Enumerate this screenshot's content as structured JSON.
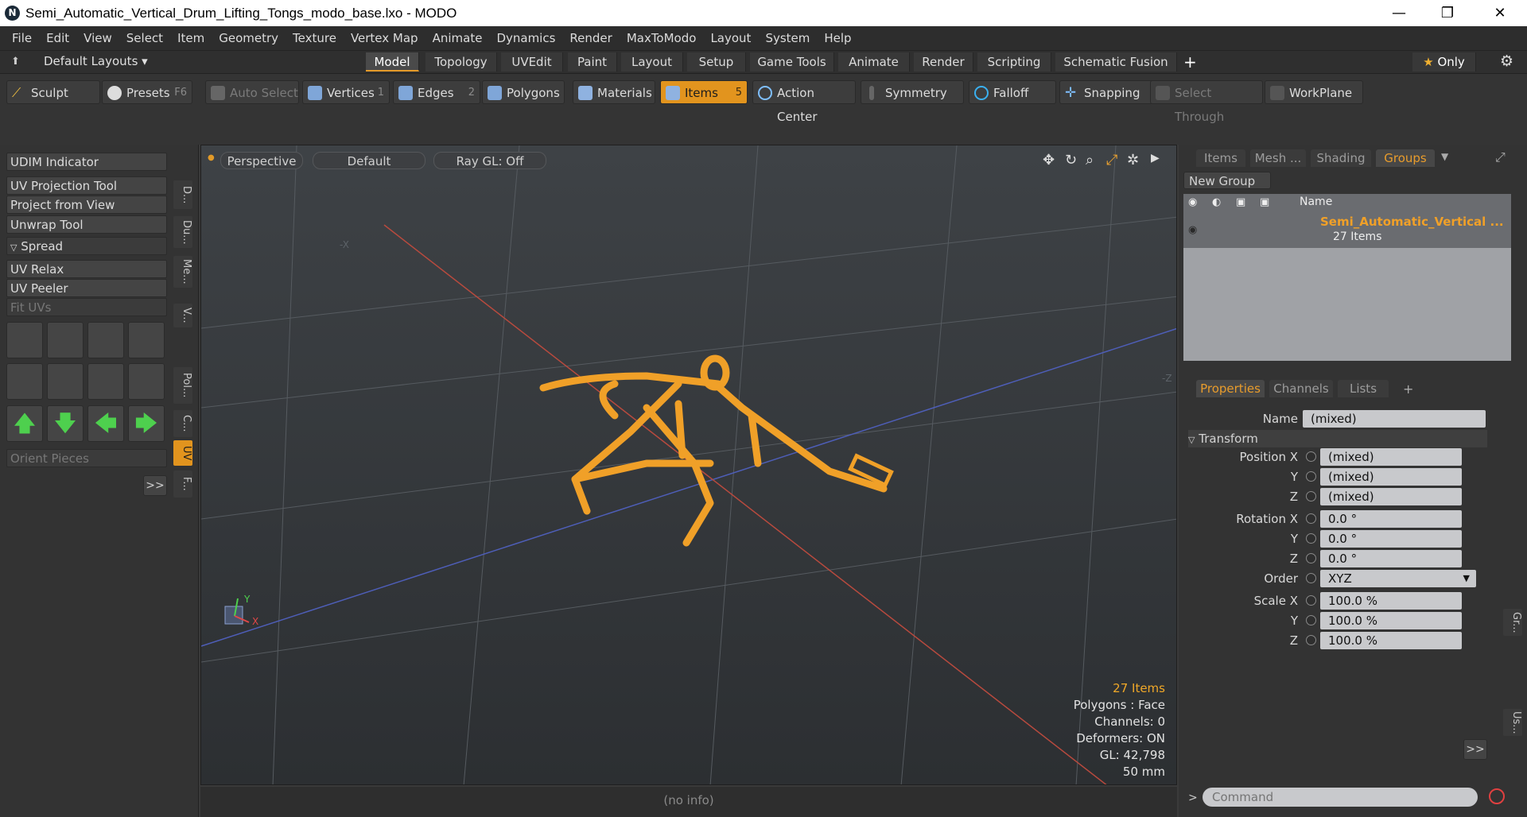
{
  "window": {
    "title": "Semi_Automatic_Vertical_Drum_Lifting_Tongs_modo_base.lxo - MODO",
    "minimize": "—",
    "maximize": "❐",
    "close": "✕"
  },
  "menu": [
    "File",
    "Edit",
    "View",
    "Select",
    "Item",
    "Geometry",
    "Texture",
    "Vertex Map",
    "Animate",
    "Dynamics",
    "Render",
    "MaxToModo",
    "Layout",
    "System",
    "Help"
  ],
  "layouts": {
    "label": "Default Layouts",
    "tabs": [
      "Model",
      "Topology",
      "UVEdit",
      "Paint",
      "Layout",
      "Setup",
      "Game Tools",
      "Animate",
      "Render",
      "Scripting",
      "Schematic Fusion"
    ],
    "active": "Model",
    "add": "+",
    "only_label": "Only"
  },
  "toolbar": {
    "sculpt": "Sculpt",
    "presets": "Presets",
    "presets_key": "F6",
    "auto_select": "Auto Select",
    "vertices": "Vertices",
    "vertices_key": "1",
    "edges": "Edges",
    "edges_key": "2",
    "polygons": "Polygons",
    "materials": "Materials",
    "items": "Items",
    "items_key": "5",
    "action_center": "Action Center",
    "symmetry": "Symmetry",
    "falloff": "Falloff",
    "snapping": "Snapping",
    "select_through": "Select Through",
    "workplane": "WorkPlane"
  },
  "left_panel": {
    "buttons": [
      "UDIM Indicator",
      "UV Projection Tool",
      "Project from View",
      "Unwrap Tool"
    ],
    "spread": "Spread",
    "buttons2": [
      "UV Relax",
      "UV Peeler"
    ],
    "fit_uvs": "Fit UVs",
    "orient_pieces": "Orient Pieces",
    "more": ">>",
    "vtabs": [
      "D...",
      "Du...",
      "Me...",
      "V...",
      "Pol...",
      "C...",
      "UV",
      "F..."
    ]
  },
  "viewport": {
    "dot": "●",
    "perspective": "Perspective",
    "default": "Default",
    "raygl": "Ray GL: Off",
    "neg_x": "-X",
    "neg_z": "-Z",
    "axis_y": "Y",
    "axis_x": "X",
    "stats": {
      "items": "27 Items",
      "polygons": "Polygons : Face",
      "channels": "Channels: 0",
      "deformers": "Deformers: ON",
      "gl": "GL: 42,798",
      "unit": "50 mm"
    },
    "status": "(no info)"
  },
  "groups_panel": {
    "tabs": [
      "Items",
      "Mesh ...",
      "Shading",
      "Groups"
    ],
    "active": "Groups",
    "new_group": "New Group",
    "name_col": "Name",
    "group_name": "Semi_Automatic_Vertical ...",
    "group_count": "27 Items"
  },
  "properties_panel": {
    "tabs": [
      "Properties",
      "Channels",
      "Lists"
    ],
    "active": "Properties",
    "add": "+",
    "name_label": "Name",
    "name_value": "(mixed)",
    "section": "Transform",
    "rows": [
      {
        "label": "Position X",
        "value": "(mixed)"
      },
      {
        "label": "Y",
        "value": "(mixed)"
      },
      {
        "label": "Z",
        "value": "(mixed)"
      },
      {
        "label": "Rotation X",
        "value": "0.0 °"
      },
      {
        "label": "Y",
        "value": "0.0 °"
      },
      {
        "label": "Z",
        "value": "0.0 °"
      },
      {
        "label": "Order",
        "value": "XYZ"
      },
      {
        "label": "Scale X",
        "value": "100.0 %"
      },
      {
        "label": "Y",
        "value": "100.0 %"
      },
      {
        "label": "Z",
        "value": "100.0 %"
      }
    ],
    "more": ">>",
    "vtabs": [
      "Gr...",
      "Us..."
    ]
  },
  "command": {
    "prompt": ">",
    "placeholder": "Command"
  },
  "colors": {
    "accent": "#e2941e",
    "selection": "#f0a028",
    "background": "#333333"
  }
}
